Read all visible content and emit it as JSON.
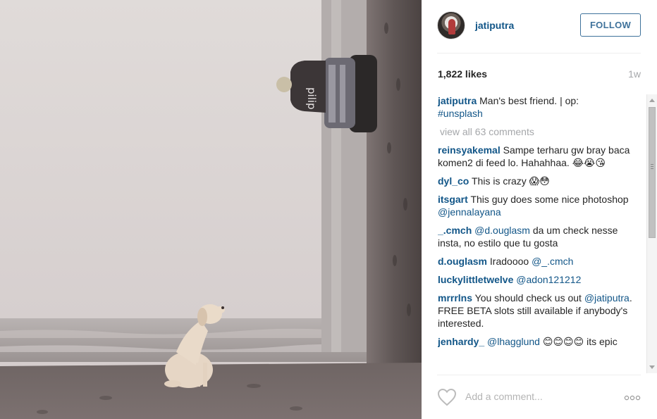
{
  "post": {
    "username": "jatiputra",
    "follow_label": "FOLLOW",
    "likes": "1,822 likes",
    "age": "1w"
  },
  "caption": {
    "user": "jatiputra",
    "text": "Man's best friend. | op:",
    "tag": "#unsplash"
  },
  "view_all": "view all 63 comments",
  "comments": [
    {
      "user": "reinsyakemal",
      "text": "Sampe terharu gw bray baca komen2 di feed lo. Hahahhaa. 😂😭😘"
    },
    {
      "user": "dyl_co",
      "text": "This is crazy 😱😳"
    },
    {
      "user": "itsgart",
      "text": "This guy does some nice photoshop",
      "mention": "@jennalayana"
    },
    {
      "user": "_.cmch",
      "mention_first": "@d.ouglasm",
      "text": "da um check nesse insta, no estilo que tu gosta"
    },
    {
      "user": "d.ouglasm",
      "text": "Iradoooo",
      "mention": "@_.cmch"
    },
    {
      "user": "luckylittletwelve",
      "mention_first": "@adon121212",
      "text": ""
    },
    {
      "user": "mrrrlns",
      "text": "You should check us out",
      "mention": "@jatiputra",
      "text2": ". FREE BETA slots still available if anybody's interested."
    },
    {
      "user": "jenhardy_",
      "mention_first": "@lhagglund",
      "text": "😊😊😊😊 its epic"
    }
  ],
  "add_comment_placeholder": "Add a comment...",
  "icons": {
    "heart": "heart-icon",
    "more": "more-options-icon"
  },
  "colors": {
    "link": "#125688",
    "follow": "#3f729b",
    "muted": "#a5a7aa"
  }
}
